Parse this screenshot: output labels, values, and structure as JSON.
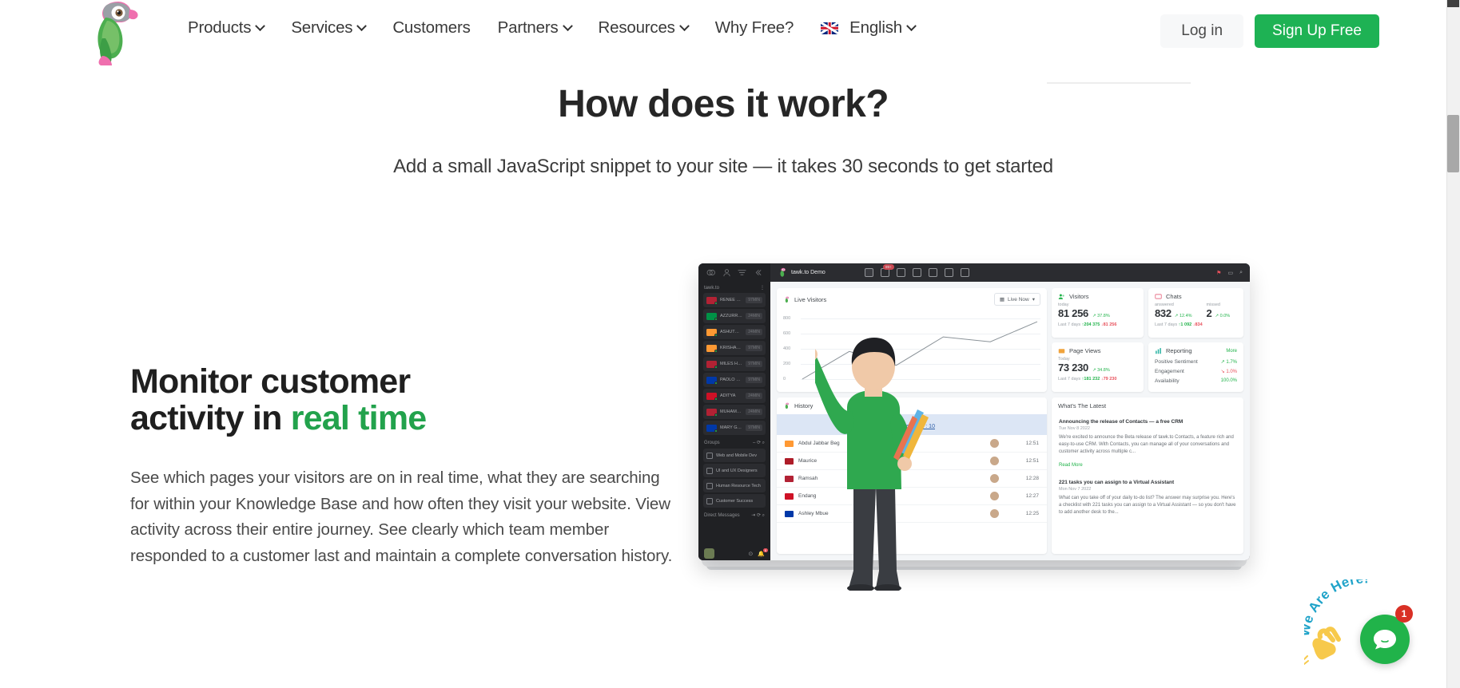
{
  "header": {
    "logo_alt": "tawk.to parrot logo",
    "nav": [
      {
        "label": "Products",
        "has_dropdown": true
      },
      {
        "label": "Services",
        "has_dropdown": true
      },
      {
        "label": "Customers",
        "has_dropdown": false
      },
      {
        "label": "Partners",
        "has_dropdown": true
      },
      {
        "label": "Resources",
        "has_dropdown": true
      },
      {
        "label": "Why Free?",
        "has_dropdown": false
      }
    ],
    "language": {
      "label": "English",
      "flag": "uk-flag-icon"
    },
    "login_label": "Log in",
    "signup_label": "Sign Up Free",
    "accent_green": "#1eb254"
  },
  "hero": {
    "title": "How does it work?",
    "subtitle": "Add a small JavaScript snippet to your site — it takes 30 seconds to get started"
  },
  "feature": {
    "heading_line1": "Monitor customer",
    "heading_line2_plain": "activity in ",
    "heading_line2_accent": "real time",
    "accent_color": "#22a24c",
    "body": "See which pages your visitors are on in real time, what they are searching for within your Knowledge Base and how often they visit your website. View activity across their entire journey. See clearly which team member responded to a customer last and maintain a complete conversation history."
  },
  "dashboard": {
    "topbar": {
      "brand": "tawk.to Demo",
      "chat_badge": "99+",
      "icons": [
        "home-icon",
        "chat-icon",
        "contacts-icon",
        "knowledge-base-icon",
        "ticketing-icon",
        "apps-icon",
        "settings-icon"
      ],
      "right_icons": [
        "pin-icon",
        "window-icon",
        "search-icon"
      ]
    },
    "rail": {
      "header": "tawk.to",
      "top_icons": [
        "chats-icon",
        "contacts-icon",
        "filter-icon",
        "collapse-icon"
      ],
      "visitors": [
        {
          "name": "RENEE TAYLOR",
          "time": "97MIN",
          "flag": "#b22234"
        },
        {
          "name": "AZZURRA VO...",
          "time": "24MIN",
          "flag": "#009246"
        },
        {
          "name": "ASHUTOSH",
          "time": "24MIN",
          "flag": "#ff9933"
        },
        {
          "name": "KRISHAN KU...",
          "time": "97MIN",
          "flag": "#ff9933"
        },
        {
          "name": "MILES HARVI...",
          "time": "97MIN",
          "flag": "#b22234"
        },
        {
          "name": "PAOLO REME...",
          "time": "97MIN",
          "flag": "#0038a8"
        },
        {
          "name": "ADITYA",
          "time": "24MIN",
          "flag": "#ce1126"
        },
        {
          "name": "MUHAMMA...",
          "time": "24MIN",
          "flag": "#b22234"
        },
        {
          "name": "MARY GRACE...",
          "time": "97MIN",
          "flag": "#0038a8"
        }
      ],
      "groups_label": "Groups",
      "groups": [
        {
          "name": "Web and Mobile Dev"
        },
        {
          "name": "UI and UX Designers"
        },
        {
          "name": "Human Resource Tech"
        },
        {
          "name": "Customer Success"
        }
      ],
      "direct_messages_label": "Direct Messages",
      "notification_count": "6"
    },
    "live_visitors": {
      "title": "Live Visitors",
      "range_label": "Live Now",
      "chart": {
        "type": "line",
        "yticks": [
          "800",
          "600",
          "400",
          "200",
          "0"
        ],
        "ymax": 900,
        "values": [
          0,
          400,
          200,
          610,
          540,
          830
        ],
        "line_color": "#8a9298"
      }
    },
    "cards": {
      "visitors": {
        "title": "Visitors",
        "period_label": "today",
        "value": "81 256",
        "delta": "37.8%",
        "footer_label": "Last 7 days",
        "footer_up": "204 375",
        "footer_down": "81 256"
      },
      "chats": {
        "title": "Chats",
        "answered_label": "answered",
        "answered_value": "832",
        "answered_delta": "12.4%",
        "missed_label": "missed",
        "missed_value": "2",
        "missed_delta": "0.0%",
        "footer_label": "Last 7 days",
        "footer_up": "1 092",
        "footer_down": "834"
      },
      "page_views": {
        "title": "Page Views",
        "period_label": "Today",
        "value": "73 230",
        "delta": "34.8%",
        "footer_label": "Last 7 days",
        "footer_up": "181 232",
        "footer_down": "79 230"
      },
      "reporting": {
        "title": "Reporting",
        "more_label": "More",
        "rows": [
          {
            "label": "Positive Sentiment",
            "value": "1.7%",
            "direction": "up"
          },
          {
            "label": "Engagement",
            "value": "1.0%",
            "direction": "down"
          },
          {
            "label": "Availability",
            "value": "100.0%",
            "direction": "flat"
          }
        ]
      }
    },
    "history": {
      "title": "History",
      "banner": "New Message : 10",
      "rows": [
        {
          "name": "Abdul Jabbar Beg",
          "time": "12:51",
          "flag": "#ff9933"
        },
        {
          "name": "Maurice",
          "time": "12:51",
          "flag": "#ae1c28"
        },
        {
          "name": "Ramsah",
          "time": "12:28",
          "flag": "#b22234"
        },
        {
          "name": "Endang",
          "time": "12:27",
          "flag": "#ce1126"
        },
        {
          "name": "Ashley Mbue",
          "time": "12:25",
          "flag": "#0038a8"
        }
      ]
    },
    "latest": {
      "title": "What's The Latest",
      "items": [
        {
          "title": "Announcing the release of Contacts — a free CRM",
          "date": "Tue Nov 8 2022",
          "body": "We're excited to announce the Beta release of tawk.to Contacts, a feature rich and easy-to-use CRM. With Contacts, you can manage all of your conversations and customer activity across multiple c...",
          "more": "Read More"
        },
        {
          "title": "221 tasks you can assign to a Virtual Assistant",
          "date": "Mon Nov 7 2022",
          "body": "What can you take off of your daily to-do list? The answer may surprise you. Here's a checklist with 221 tasks you can assign to a Virtual Assistant — so you don't have to add another desk to the..."
        }
      ]
    }
  },
  "chat_widget": {
    "greeting": "We Are Here!",
    "badge_count": "1",
    "bubble_color": "#21b34a",
    "badge_color": "#d93025"
  }
}
